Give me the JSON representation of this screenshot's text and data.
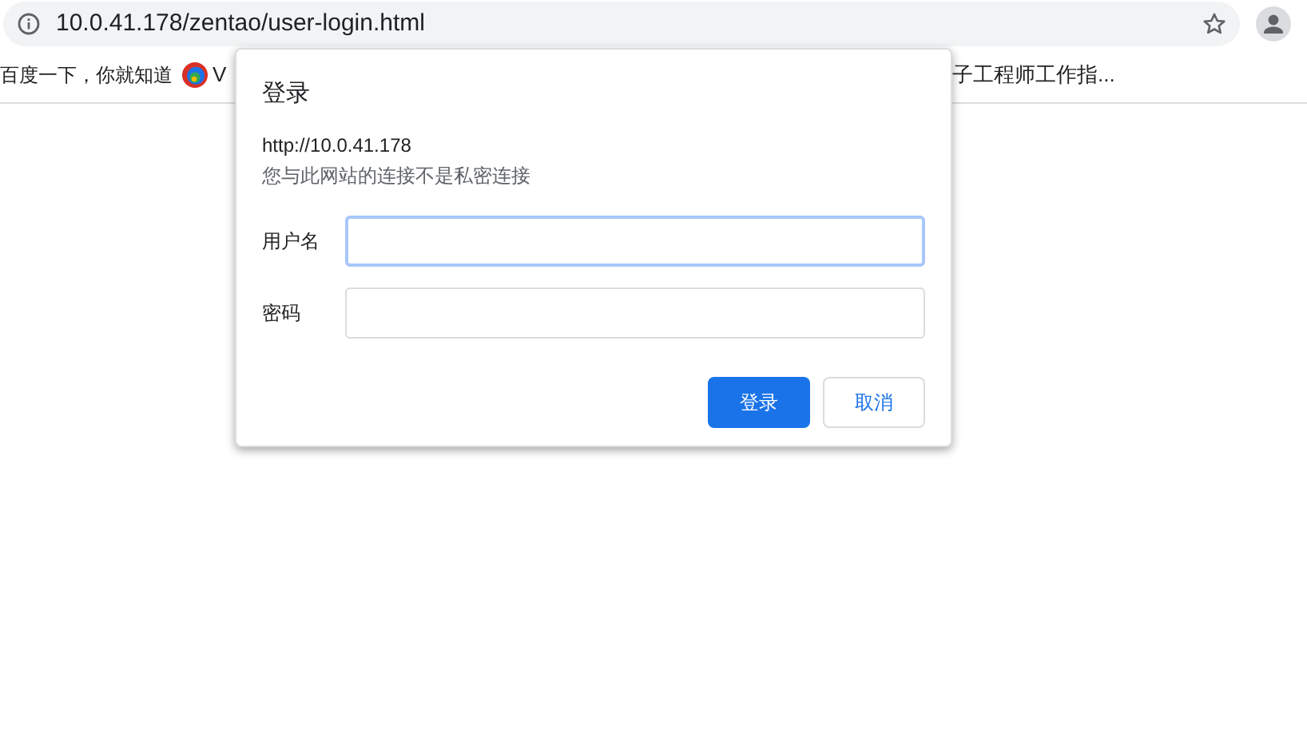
{
  "address_bar": {
    "url": "10.0.41.178/zentao/user-login.html"
  },
  "bookmarks": [
    {
      "label": "百度一下，你就知道",
      "kind": "text"
    },
    {
      "label": "V",
      "kind": "logo"
    },
    {
      "label": "子工程师工作指...",
      "kind": "text"
    }
  ],
  "dialog": {
    "title": "登录",
    "origin": "http://10.0.41.178",
    "notice": "您与此网站的连接不是私密连接",
    "fields": [
      {
        "label": "用户名",
        "focused": true
      },
      {
        "label": "密码",
        "focused": false
      }
    ],
    "buttons": [
      {
        "label": "登录",
        "kind": "primary"
      },
      {
        "label": "取消",
        "kind": "secondary"
      }
    ]
  }
}
